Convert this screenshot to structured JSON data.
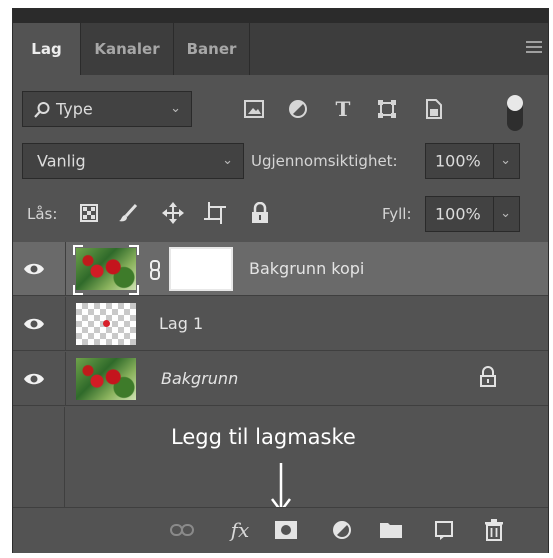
{
  "tabs": [
    {
      "label": "Lag",
      "active": true
    },
    {
      "label": "Kanaler",
      "active": false
    },
    {
      "label": "Baner",
      "active": false
    }
  ],
  "filter": {
    "kind_label": "Type",
    "icons": [
      "image-filter-icon",
      "adjustment-filter-icon",
      "type-filter-icon",
      "shape-filter-icon",
      "smart-object-filter-icon"
    ],
    "filter_toggle": "on"
  },
  "blend": {
    "mode": "Vanlig",
    "opacity_label": "Ugjennomsiktighet:",
    "opacity_value": "100%"
  },
  "lock": {
    "label": "Lås:",
    "icons": [
      "lock-transparent-pixels-icon",
      "lock-image-pixels-icon",
      "lock-position-icon",
      "lock-artboard-icon",
      "lock-all-icon"
    ],
    "fill_label": "Fyll:",
    "fill_value": "100%"
  },
  "layers": [
    {
      "name": "Bakgrunn kopi",
      "selected": true,
      "visible": true,
      "has_mask": true,
      "thumbnail": "photo",
      "italic": false,
      "locked": false
    },
    {
      "name": "Lag 1",
      "selected": false,
      "visible": true,
      "has_mask": false,
      "thumbnail": "transparent-with-dot",
      "italic": false,
      "locked": false
    },
    {
      "name": "Bakgrunn",
      "selected": false,
      "visible": true,
      "has_mask": false,
      "thumbnail": "photo",
      "italic": true,
      "locked": true
    }
  ],
  "annotation": {
    "text": "Legg til lagmaske"
  },
  "bottom_bar": {
    "icons": [
      "link-layers-icon",
      "fx-icon",
      "add-layer-mask-icon",
      "adjustment-layer-icon",
      "group-folder-icon",
      "new-layer-icon",
      "delete-layer-icon"
    ],
    "fx_text": "fx"
  },
  "colors": {
    "panel_bg": "#535353",
    "tab_bar_bg": "#3d3d3d",
    "selected_row_bg": "#6a6a6a",
    "field_bg": "#424242"
  }
}
